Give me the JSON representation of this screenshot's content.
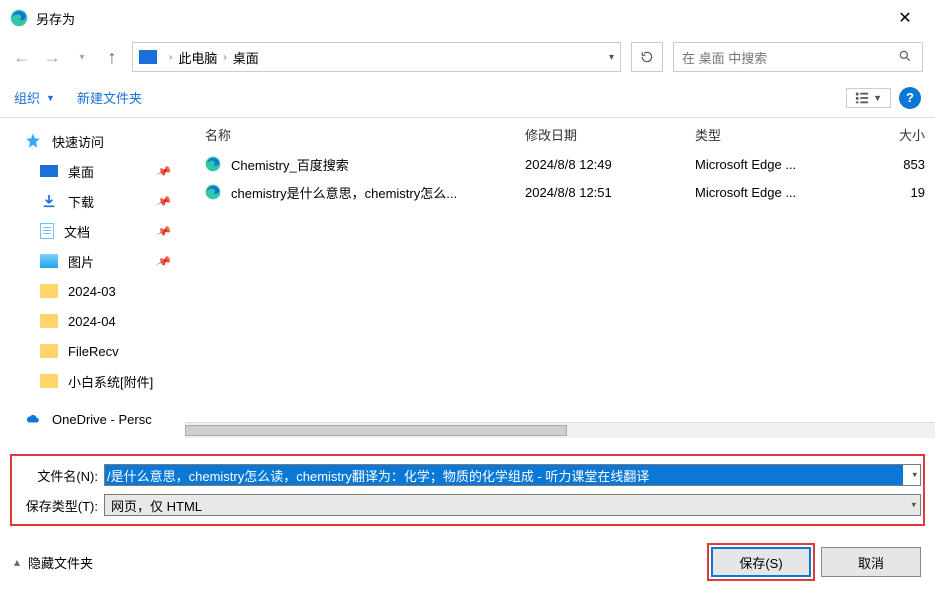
{
  "window": {
    "title": "另存为"
  },
  "nav": {
    "breadcrumb1": "此电脑",
    "breadcrumb2": "桌面",
    "search_placeholder": "在 桌面 中搜索"
  },
  "toolbar": {
    "organize": "组织",
    "new_folder": "新建文件夹"
  },
  "sidebar": {
    "quick_access": "快速访问",
    "desktop": "桌面",
    "downloads": "下载",
    "documents": "文档",
    "pictures": "图片",
    "folder1": "2024-03",
    "folder2": "2024-04",
    "folder3": "FileRecv",
    "folder4": "小白系统[附件]",
    "onedrive": "OneDrive - Persc"
  },
  "columns": {
    "name": "名称",
    "date": "修改日期",
    "type": "类型",
    "size": "大小"
  },
  "files": [
    {
      "name": "Chemistry_百度搜索",
      "date": "2024/8/8 12:49",
      "type": "Microsoft Edge ...",
      "size": "853"
    },
    {
      "name": "chemistry是什么意思，chemistry怎么...",
      "date": "2024/8/8 12:51",
      "type": "Microsoft Edge ...",
      "size": "19"
    }
  ],
  "form": {
    "filename_label": "文件名(N):",
    "filename_value": "/是什么意思，chemistry怎么读，chemistry翻译为：化学；物质的化学组成 - 听力课堂在线翻译",
    "filetype_label": "保存类型(T):",
    "filetype_value": "网页，仅 HTML"
  },
  "footer": {
    "hide_folders": "隐藏文件夹",
    "save": "保存(S)",
    "cancel": "取消"
  }
}
